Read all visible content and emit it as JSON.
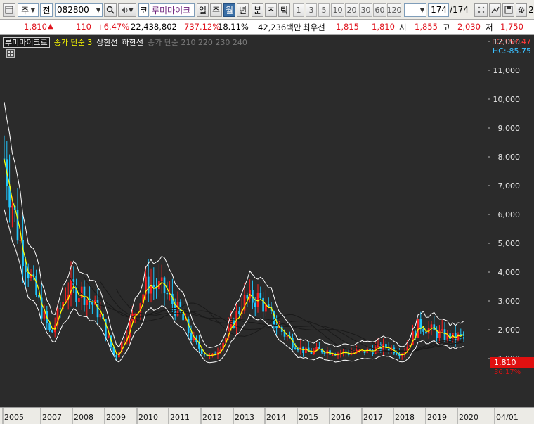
{
  "toolbar": {
    "period_a": "주",
    "field_b": "전",
    "code": "082800",
    "market": "코",
    "stock_name": "루미마이크",
    "period_buttons": [
      "일",
      "주",
      "월",
      "년",
      "분",
      "초",
      "틱"
    ],
    "selected_period": "월",
    "numbers": [
      "1",
      "3",
      "5",
      "10",
      "20",
      "30",
      "60",
      "120"
    ],
    "page_count": "174",
    "page_total": "/174",
    "right_label": "2"
  },
  "quote": {
    "price": "1,810",
    "arrow": "▲",
    "change": "110",
    "change_pct": "+6.47%",
    "volume": "22,438,802",
    "volume_ratio": "737.12%",
    "turnover": "18.11%",
    "amount": "42,236백만",
    "pref_label": "최우선",
    "ask": "1,815",
    "bid": "1,810",
    "open_label": "시",
    "open": "1,855",
    "high_label": "고",
    "high": "2,030",
    "low_label": "저",
    "low": "1,750"
  },
  "chart": {
    "name": "루미마이크로",
    "legend_1": "종가 단순 3",
    "legend_2": "상한선",
    "legend_3": "하한선",
    "legend_4": "종가 단순 210 220 230 240",
    "lc": "LC:157.47",
    "hc": "HC:-85.75",
    "current_price": "1,810",
    "current_pct": "36.17%",
    "y_ticks": [
      "12,000",
      "11,000",
      "10,000",
      "9,000",
      "8,000",
      "7,000",
      "6,000",
      "5,000",
      "4,000",
      "3,000",
      "2,000",
      "1,000"
    ],
    "x_ticks": [
      "2005",
      "2007",
      "2008",
      "2009",
      "2010",
      "2011",
      "2012",
      "2013",
      "2014",
      "2015",
      "2016",
      "2017",
      "2018",
      "2019",
      "2020",
      "04/01"
    ],
    "colors": {
      "up": "#ff2020",
      "down": "#20c8ff",
      "ma": "#ffff00",
      "band": "#ffffff",
      "long_ma": "#1a1a1a"
    }
  },
  "chart_data": {
    "type": "candlestick",
    "title": "루미마이크로",
    "ylim": [
      0,
      12500
    ],
    "x_range": [
      "2005-01",
      "2020-04"
    ],
    "series": [
      {
        "name": "종가 단순 3",
        "x": [
          "2005-01",
          "2005-07",
          "2006-01",
          "2006-07",
          "2007-01",
          "2007-07",
          "2008-01",
          "2008-07",
          "2009-01",
          "2009-07",
          "2010-01",
          "2010-07",
          "2011-01",
          "2011-07",
          "2012-01",
          "2012-07",
          "2013-01",
          "2013-07",
          "2014-01",
          "2014-07",
          "2015-01",
          "2015-07",
          "2016-01",
          "2016-07",
          "2017-01",
          "2017-07",
          "2018-01",
          "2018-07",
          "2019-01",
          "2019-07",
          "2020-01",
          "2020-04"
        ],
        "y": [
          8200,
          5200,
          3300,
          1800,
          3400,
          3300,
          2600,
          1000,
          2300,
          3600,
          3400,
          2600,
          1500,
          1000,
          1800,
          3000,
          3100,
          2200,
          1600,
          1200,
          1300,
          1200,
          1200,
          1300,
          1400,
          1200,
          2200,
          1900,
          1700,
          1800,
          2600,
          1810
        ]
      }
    ]
  }
}
